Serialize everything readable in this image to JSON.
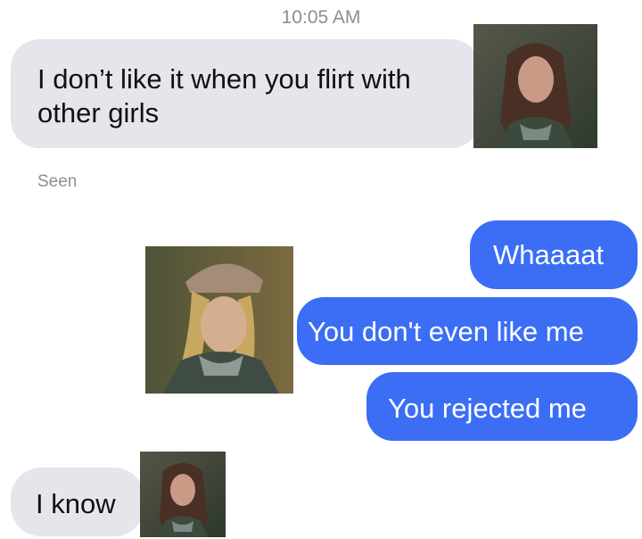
{
  "conversation": {
    "timestamp": "10:05 AM",
    "messages": [
      {
        "from": "them",
        "text_lines": [
          "I don’t like it when you flirt with",
          "other girls"
        ]
      },
      {
        "from": "them_status",
        "text": "Seen"
      },
      {
        "from": "me",
        "text": "Whaaaat"
      },
      {
        "from": "me",
        "text": "You don't even like me"
      },
      {
        "from": "me",
        "text": "You rejected me"
      },
      {
        "from": "them",
        "text": "I know"
      }
    ]
  },
  "colors": {
    "incoming_bubble": "#e6e5eb",
    "outgoing_bubble": "#3b6ef5",
    "meta_text": "#8e8e93"
  },
  "images": {
    "photo_top_right": "reaction-photo-woman-dark-hair",
    "photo_middle_left": "reaction-photo-woman-cap",
    "photo_bottom": "reaction-photo-woman-dark-hair"
  }
}
